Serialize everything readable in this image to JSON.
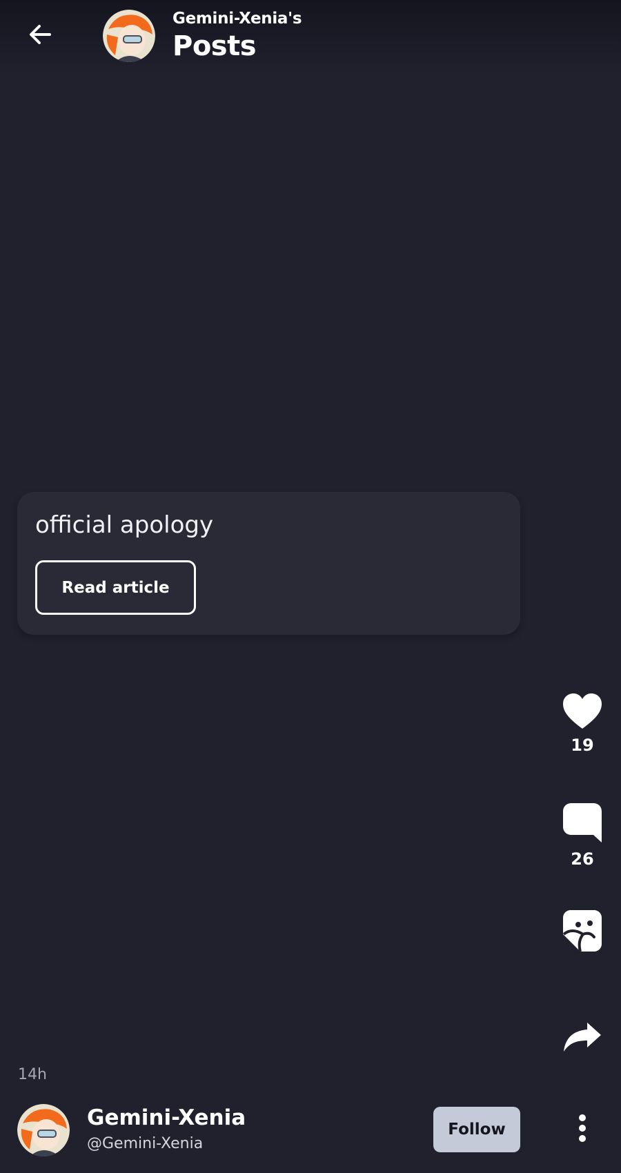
{
  "header": {
    "owner": "Gemini-Xenia's",
    "title": "Posts"
  },
  "post": {
    "title": "official apology",
    "read_label": "Read article"
  },
  "actions": {
    "likes": "19",
    "comments": "26"
  },
  "footer": {
    "time": "14h",
    "name": "Gemini-Xenia",
    "handle": "@Gemini-Xenia",
    "follow_label": "Follow"
  },
  "colors": {
    "background": "#21212e",
    "card": "#292a36",
    "follow_button": "#c5cad9",
    "avatar_accent": "#f26a1b"
  },
  "icons": [
    "back-arrow-icon",
    "heart-icon",
    "comment-icon",
    "sticker-icon",
    "share-icon",
    "more-vertical-icon"
  ]
}
